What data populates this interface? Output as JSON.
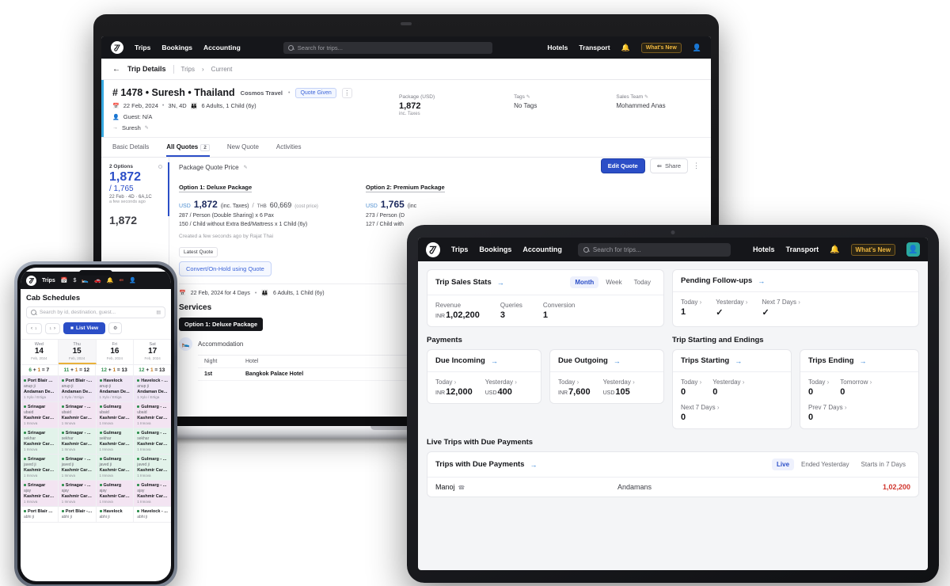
{
  "laptop": {
    "topnav": {
      "logo": "logo-icon",
      "links": [
        "Trips",
        "Bookings",
        "Accounting"
      ],
      "search_placeholder": "Search for trips...",
      "right_links": [
        "Hotels",
        "Transport"
      ],
      "bell": "bell-icon",
      "whats_new": "What's New",
      "user": "user-icon"
    },
    "breadcrumb": {
      "back": "←",
      "title": "Trip Details",
      "items": [
        "Trips",
        "Current"
      ],
      "separator": "›"
    },
    "trip": {
      "title": "# 1478 • Suresh • Thailand",
      "agency": "Cosmos Travel",
      "status_badge": "Quote Given",
      "date": "22 Feb, 2024",
      "nights": "3N, 4D",
      "pax": "6 Adults, 1 Child (6y)",
      "guest": "Guest: N/A",
      "lead": "Suresh",
      "stats": [
        {
          "label": "Package (USD)",
          "value": "1,872",
          "sub": "inc. Taxes"
        },
        {
          "label": "Tags",
          "value": "No Tags"
        },
        {
          "label": "Sales Team",
          "value": "Mohammed Anas"
        }
      ]
    },
    "tabs": [
      {
        "label": "Basic Details",
        "count": "",
        "active": false
      },
      {
        "label": "All Quotes",
        "count": "2",
        "active": true
      },
      {
        "label": "New Quote",
        "count": "",
        "active": false
      },
      {
        "label": "Activities",
        "count": "",
        "active": false
      }
    ],
    "quote_sidebar": {
      "options_label": "2 Options",
      "primary": "1,872",
      "secondary": "/ 1,765",
      "meta": "22 Feb · 4D · 6A,1C",
      "ago": "a few seconds ago",
      "next_primary": "1,872"
    },
    "quote_panel": {
      "header": "Package Quote Price",
      "edit_icon": "pencil-icon",
      "actions": {
        "edit": "Edit Quote",
        "share": "Share",
        "more": "⋮"
      },
      "options": [
        {
          "name": "Option 1: Deluxe Package",
          "currency": "USD",
          "price": "1,872",
          "inc": "(inc. Taxes)",
          "cost_currency": "THB",
          "cost": "60,669",
          "cost_note": "(cost price)",
          "line1": "287 / Person (Double Sharing) x 6 Pax",
          "line2": "150 / Child without Extra Bed/Mattress x 1 Child (6y)"
        },
        {
          "name": "Option 2: Premium Package",
          "currency": "USD",
          "price": "1,765",
          "inc": "(inc",
          "cost_currency": "",
          "cost": "",
          "cost_note": "",
          "line1": "273 / Person (D",
          "line2": "127 / Child with"
        }
      ],
      "created": "Created a few seconds ago by Rajat Thai",
      "latest_quote": "Latest Quote",
      "convert": "Convert/On-Hold using Quote",
      "detail_line": "22 Feb, 2024 for 4 Days",
      "detail_pax": "6 Adults, 1 Child (6y)",
      "services_title": "Services",
      "services_pill": "Option 1: Deluxe Package",
      "accommodation": {
        "label": "Accommodation",
        "icon": "bed-icon",
        "columns": [
          "Night",
          "Hotel"
        ],
        "rows": [
          [
            "1st",
            "Bangkok Palace Hotel"
          ]
        ]
      }
    }
  },
  "tablet": {
    "topnav": {
      "links": [
        "Trips",
        "Bookings",
        "Accounting"
      ],
      "search_placeholder": "Search for trips...",
      "right_links": [
        "Hotels",
        "Transport"
      ],
      "whats_new": "What's New"
    },
    "trip_sales_stats": {
      "title": "Trip Sales Stats",
      "segments": [
        "Month",
        "Week",
        "Today"
      ],
      "active_segment": "Month",
      "metrics": [
        {
          "label": "Revenue",
          "currency": "INR",
          "value": "1,02,200"
        },
        {
          "label": "Queries",
          "currency": "",
          "value": "3"
        },
        {
          "label": "Conversion",
          "currency": "",
          "value": "1"
        }
      ]
    },
    "pending_followups": {
      "title": "Pending Follow-ups",
      "metrics": [
        {
          "label": "Today",
          "value": "1",
          "check": false
        },
        {
          "label": "Yesterday",
          "value": "",
          "check": true
        },
        {
          "label": "Next 7 Days",
          "value": "",
          "check": true
        }
      ]
    },
    "payments": {
      "section_title": "Payments",
      "cards": [
        {
          "title": "Due Incoming",
          "metrics": [
            {
              "label": "Today",
              "currency": "INR",
              "value": "12,000"
            },
            {
              "label": "Yesterday",
              "currency": "USD",
              "value": "400"
            }
          ]
        },
        {
          "title": "Due Outgoing",
          "metrics": [
            {
              "label": "Today",
              "currency": "INR",
              "value": "7,600"
            },
            {
              "label": "Yesterday",
              "currency": "USD",
              "value": "105"
            }
          ]
        }
      ]
    },
    "trip_start_end": {
      "section_title": "Trip Starting and Endings",
      "cards": [
        {
          "title": "Trips Starting",
          "metrics": [
            {
              "label": "Today",
              "value": "0"
            },
            {
              "label": "Yesterday",
              "value": "0"
            },
            {
              "label": "Next 7 Days",
              "value": "0"
            }
          ]
        },
        {
          "title": "Trips Ending",
          "metrics": [
            {
              "label": "Today",
              "value": "0"
            },
            {
              "label": "Tomorrow",
              "value": "0"
            },
            {
              "label": "Prev 7 Days",
              "value": "0"
            }
          ]
        }
      ]
    },
    "live_trips": {
      "section_title": "Live Trips with Due Payments",
      "title": "Trips with Due Payments",
      "segments": [
        "Live",
        "Ended Yesterday",
        "Starts in 7 Days"
      ],
      "active_segment": "Live",
      "rows": [
        {
          "name": "Manoj",
          "destination": "Andamans",
          "amount": "1,02,200"
        }
      ]
    }
  },
  "phone": {
    "topnav": {
      "label": "Trips",
      "icons": [
        "calendar-icon",
        "dollar-icon",
        "bed-icon",
        "car-icon",
        "bell-icon",
        "share-icon",
        "user-icon"
      ]
    },
    "title": "Cab Schedules",
    "search_placeholder": "Search by id, destination, guest...",
    "controls": {
      "prev": "‹",
      "next": "›",
      "list_view": "List View",
      "settings": "gear-icon"
    },
    "calendar": {
      "days": [
        {
          "dow": "Wed",
          "day": "14",
          "month": "Feb, 2024",
          "selected": false
        },
        {
          "dow": "Thu",
          "day": "15",
          "month": "Feb, 2024",
          "selected": true
        },
        {
          "dow": "Fri",
          "day": "16",
          "month": "Feb, 2024",
          "selected": false
        },
        {
          "dow": "Sat",
          "day": "17",
          "month": "Feb, 2024",
          "selected": false
        }
      ],
      "summaries": [
        {
          "a": "6",
          "b": "1",
          "t": "7"
        },
        {
          "a": "11",
          "b": "1",
          "t": "12"
        },
        {
          "a": "12",
          "b": "1",
          "t": "13"
        },
        {
          "a": "12",
          "b": "1",
          "t": "13"
        }
      ],
      "rows": [
        {
          "bg": "rw-lav",
          "cells": [
            {
              "loc": "Port Blair A...",
              "guest": "anup ji",
              "vendor": "Andaman De...",
              "car": "1 Xylo / Ertiga"
            },
            {
              "loc": "Port Blair - ...",
              "guest": "anup ji",
              "vendor": "Andaman De...",
              "car": "1 Xylo / Ertiga"
            },
            {
              "loc": "Havelock",
              "guest": "anup ji",
              "vendor": "Andaman De...",
              "car": "1 Xylo / Ertiga"
            },
            {
              "loc": "Havelock - ...",
              "guest": "anup ji",
              "vendor": "Andaman De...",
              "car": "1 Xylo / Ertiga"
            }
          ]
        },
        {
          "bg": "rw-pink",
          "cells": [
            {
              "loc": "Srinagar",
              "guest": "ubaid",
              "vendor": "Kashmir Car ...",
              "car": "1 Innova"
            },
            {
              "loc": "Srinagar - ...",
              "guest": "ubaid",
              "vendor": "Kashmir Car ...",
              "car": "1 Innova"
            },
            {
              "loc": "Gulmarg",
              "guest": "ubaid",
              "vendor": "Kashmir Car ...",
              "car": "1 Innova"
            },
            {
              "loc": "Gulmarg - ...",
              "guest": "ubaid",
              "vendor": "Kashmir Car ...",
              "car": "1 Innova"
            }
          ]
        },
        {
          "bg": "rw-green",
          "cells": [
            {
              "loc": "Srinagar",
              "guest": "sekhar",
              "vendor": "Kashmir Car ...",
              "car": "1 Innova"
            },
            {
              "loc": "Srinagar - ...",
              "guest": "sekhar",
              "vendor": "Kashmir Car ...",
              "car": "1 Innova"
            },
            {
              "loc": "Gulmarg",
              "guest": "sekhar",
              "vendor": "Kashmir Car ...",
              "car": "1 Innova"
            },
            {
              "loc": "Gulmarg - ...",
              "guest": "sekhar",
              "vendor": "Kashmir Car ...",
              "car": "1 Innova"
            }
          ]
        },
        {
          "bg": "rw-green",
          "cells": [
            {
              "loc": "Srinagar",
              "guest": "javed ji",
              "vendor": "Kashmir Car ...",
              "car": "1 Innova"
            },
            {
              "loc": "Srinagar - ...",
              "guest": "javed ji",
              "vendor": "Kashmir Car ...",
              "car": "1 Innova"
            },
            {
              "loc": "Gulmarg",
              "guest": "javed ji",
              "vendor": "Kashmir Car ...",
              "car": "1 Innova"
            },
            {
              "loc": "Gulmarg - ...",
              "guest": "javed ji",
              "vendor": "Kashmir Car ...",
              "car": "1 Innova"
            }
          ]
        },
        {
          "bg": "rw-pink",
          "cells": [
            {
              "loc": "Srinagar",
              "guest": "ajay",
              "vendor": "Kashmir Car ...",
              "car": "1 Innova"
            },
            {
              "loc": "Srinagar - ...",
              "guest": "ajay",
              "vendor": "Kashmir Car ...",
              "car": "1 Innova"
            },
            {
              "loc": "Gulmarg",
              "guest": "ajay",
              "vendor": "Kashmir Car ...",
              "car": "1 Innova"
            },
            {
              "loc": "Gulmarg - ...",
              "guest": "ajay",
              "vendor": "Kashmir Car ...",
              "car": "1 Innova"
            }
          ]
        },
        {
          "bg": "rw-white",
          "cells": [
            {
              "loc": "Port Blair A...",
              "guest": "abhi ji",
              "vendor": "",
              "car": ""
            },
            {
              "loc": "Port Blair - ...",
              "guest": "abhi ji",
              "vendor": "",
              "car": ""
            },
            {
              "loc": "Havelock",
              "guest": "abhi ji",
              "vendor": "",
              "car": ""
            },
            {
              "loc": "Havelock - ...",
              "guest": "abhi ji",
              "vendor": "",
              "car": ""
            }
          ]
        }
      ]
    }
  },
  "colors": {
    "brand_blue": "#2b4ec7",
    "link_blue": "#2b7fd4",
    "dark_nav": "#15161a",
    "amber": "#f0b840",
    "red": "#d0342c",
    "green": "#1e9e52"
  }
}
